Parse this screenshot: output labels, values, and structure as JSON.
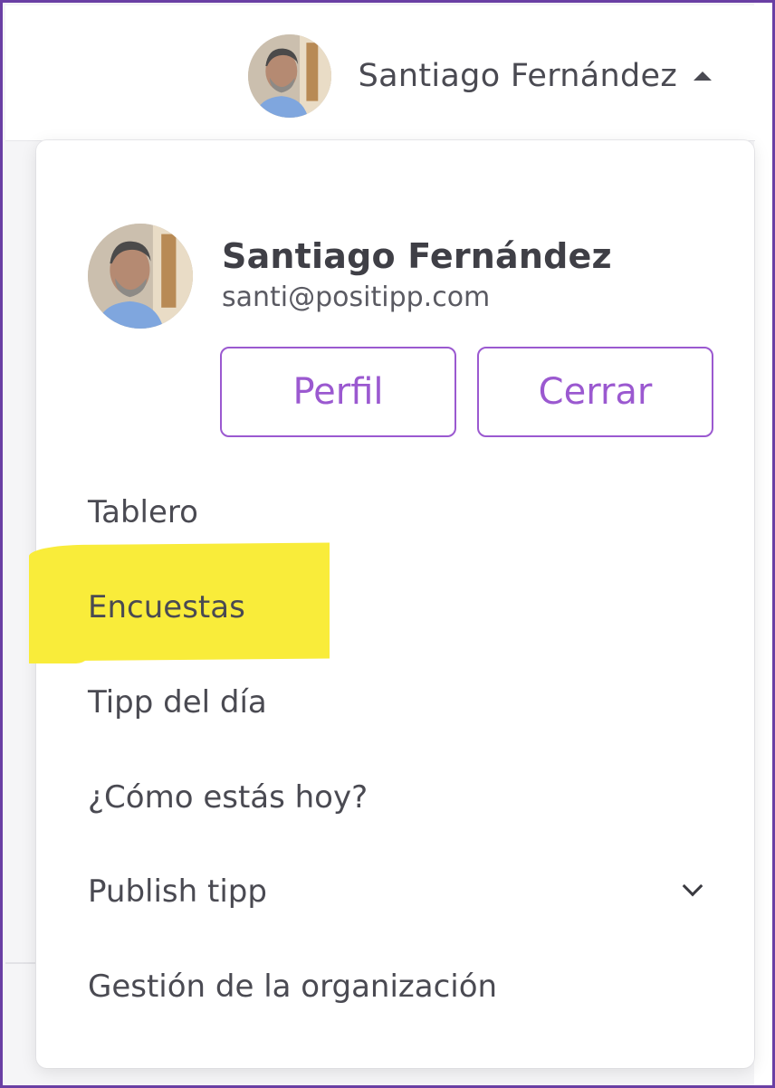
{
  "header": {
    "user_name": "Santiago Fernández"
  },
  "profile": {
    "name": "Santiago Fernández",
    "email": "santi@positipp.com",
    "buttons": {
      "profile_label": "Perfil",
      "close_label": "Cerrar"
    }
  },
  "menu": {
    "items": [
      {
        "label": "Tablero"
      },
      {
        "label": "Encuestas",
        "highlighted": true
      },
      {
        "label": "Tipp del día"
      },
      {
        "label": "¿Cómo estás hoy?"
      },
      {
        "label": "Publish tipp",
        "has_submenu": true
      },
      {
        "label": "Gestión de la organización"
      }
    ]
  },
  "colors": {
    "accent": "#9b59d0",
    "frame": "#6a3fa4",
    "highlight": "#f9ec3a",
    "text": "#4a4a52"
  },
  "icons": {
    "caret": "caret-up-icon",
    "submenu": "chevron-down-icon",
    "avatar": "avatar"
  }
}
